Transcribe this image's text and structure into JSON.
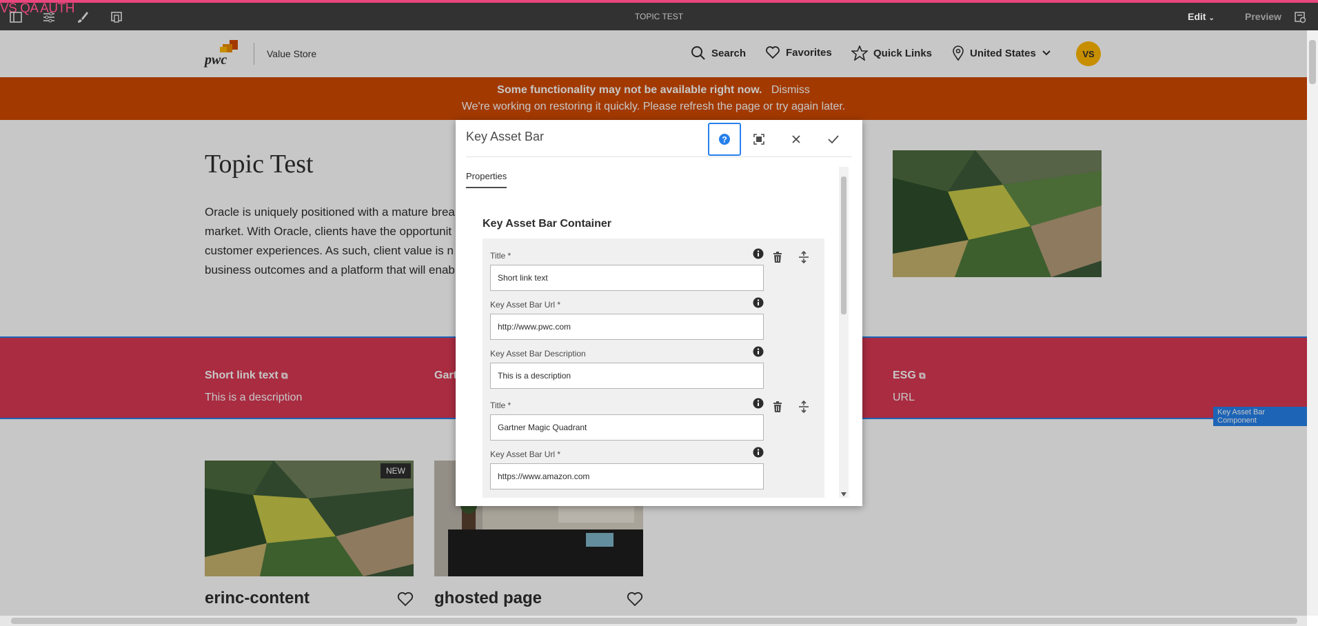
{
  "topbar": {
    "env_label": "VS QA AUTH",
    "page_title": "TOPIC TEST",
    "edit_label": "Edit",
    "preview_label": "Preview"
  },
  "header": {
    "logo_text": "pwc",
    "site_name": "Value Store",
    "nav": {
      "search": "Search",
      "favorites": "Favorites",
      "quick_links": "Quick Links",
      "region": "United States"
    },
    "avatar_initials": "VS"
  },
  "banner": {
    "headline": "Some functionality may not be available right now.",
    "dismiss": "Dismiss",
    "message": "We're working on restoring it quickly. Please refresh the page or try again later."
  },
  "hero": {
    "title": "Topic Test",
    "lines": [
      "Oracle is uniquely positioned with a mature brea",
      "market. With Oracle, clients have the opportunit",
      "customer experiences. As such, client value is n",
      "business outcomes and a platform that will enab"
    ]
  },
  "key_asset_bar": {
    "items": [
      {
        "title": "Short link text",
        "desc": "This is a description"
      },
      {
        "title": "Gart",
        "desc": ""
      },
      {
        "title": "ESG",
        "desc": "URL"
      }
    ],
    "component_tag": "Key Asset Bar Component"
  },
  "cards": [
    {
      "title": "erinc-content",
      "badge": "NEW"
    },
    {
      "title": "ghosted page",
      "badge": ""
    }
  ],
  "dialog": {
    "title": "Key Asset Bar",
    "tab": "Properties",
    "section_title": "Key Asset Bar Container",
    "fields": [
      {
        "label": "Title *",
        "value": "Short link text"
      },
      {
        "label": "Key Asset Bar Url *",
        "value": "http://www.pwc.com"
      },
      {
        "label": "Key Asset Bar Description",
        "value": "This is a description"
      },
      {
        "label": "Title *",
        "value": "Gartner Magic Quadrant"
      },
      {
        "label": "Key Asset Bar Url *",
        "value": "https://www.amazon.com"
      }
    ]
  },
  "colors": {
    "brand_orange": "#d04a02",
    "kab_red": "#d93954",
    "accent_blue": "#2680eb",
    "avatar_yellow": "#ffb600"
  }
}
